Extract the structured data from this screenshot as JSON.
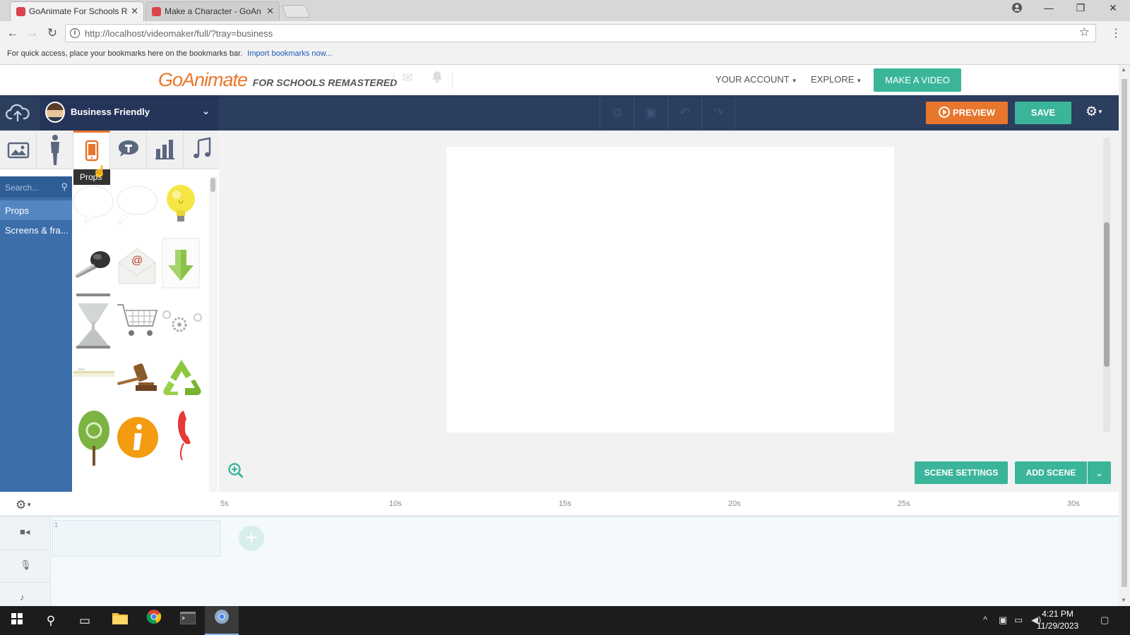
{
  "browser": {
    "tabs": [
      {
        "title": "GoAnimate For Schools R",
        "active": true
      },
      {
        "title": "Make a Character - GoAn",
        "active": false
      }
    ],
    "url": "http://localhost/videomaker/full/?tray=business",
    "bookmarks_hint": "For quick access, place your bookmarks here on the bookmarks bar.",
    "bookmarks_import": "Import bookmarks now..."
  },
  "header": {
    "brand": "GoAnimate",
    "brand_sub": "FOR SCHOOLS REMASTERED",
    "your_account": "YOUR ACCOUNT",
    "explore": "EXPLORE",
    "make_video": "MAKE A VIDEO"
  },
  "studio": {
    "theme": "Business Friendly",
    "preview": "PREVIEW",
    "save": "SAVE"
  },
  "library": {
    "tabs": [
      "background-icon",
      "character-icon",
      "props-icon",
      "text-icon",
      "chart-icon",
      "music-icon"
    ],
    "active_tab": "props",
    "tooltip": "Props",
    "search_placeholder": "Search...",
    "categories": [
      "Props",
      "Screens & fra..."
    ],
    "assets": [
      "speech-bubble",
      "thought-bubble",
      "light-bulb",
      "microphone",
      "email-envelope",
      "download-arrow",
      "hourglass",
      "shopping-cart",
      "gears",
      "pen",
      "gavel",
      "recycle-symbol",
      "tree",
      "info-sign",
      "telephone-handset"
    ]
  },
  "stage": {
    "scene_settings": "SCENE SETTINGS",
    "add_scene": "ADD SCENE"
  },
  "timeline": {
    "ticks": [
      "5s",
      "10s",
      "15s",
      "20s",
      "25s",
      "30s"
    ],
    "scene_number": "1"
  },
  "taskbar": {
    "time": "4:21 PM",
    "date": "11/29/2023"
  },
  "colors": {
    "accent_orange": "#e8762d",
    "accent_green": "#3bb599",
    "navy": "#2c3e5e",
    "sidebar_blue": "#3b6eab"
  }
}
